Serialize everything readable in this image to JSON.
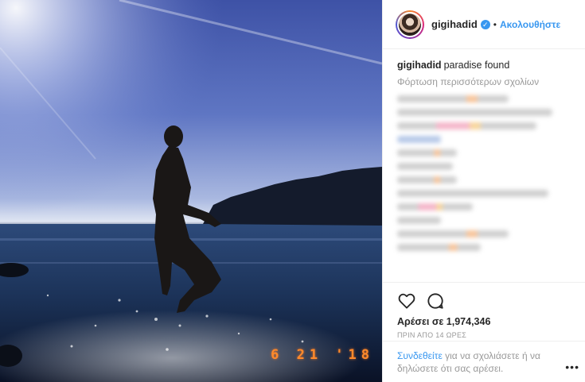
{
  "post": {
    "photo": {
      "alt": "",
      "date_stamp": "6 21 '18"
    },
    "header": {
      "username": "gigihadid",
      "verified_icon": "verified-badge-icon",
      "separator": "•",
      "follow_label": "Ακολουθήστε"
    },
    "caption": {
      "username": "gigihadid",
      "text": "paradise found"
    },
    "load_more": "Φόρτωση περισσότερων σχολίων",
    "actions": {
      "like_icon": "heart-icon",
      "comment_icon": "comment-bubble-icon",
      "likes": "Αρέσει σε 1,974,346",
      "timestamp": "ΠΡΙΝ ΑΠΟ 14 ΩΡΕΣ"
    },
    "login": {
      "link": "Συνδεθείτε",
      "rest": " για να σχολιάσετε ή να δηλώσετε ότι σας αρέσει.",
      "more_icon": "more-options-icon",
      "more_glyph": "•••"
    }
  },
  "colors": {
    "accent": "#3897f0",
    "muted": "#999999",
    "text": "#262626",
    "date_stamp": "#ff8a2b"
  }
}
